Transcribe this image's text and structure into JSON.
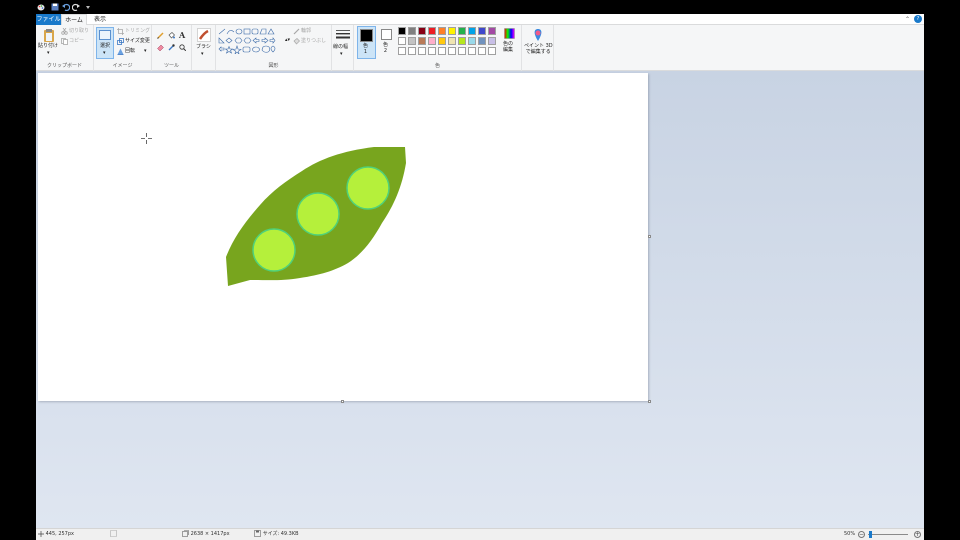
{
  "tabs": {
    "file": "ファイル",
    "home": "ホーム",
    "view": "表示"
  },
  "help": "?",
  "clipboard": {
    "paste": "貼り付け",
    "cut": "切り取り",
    "copy": "コピー",
    "label": "クリップボード"
  },
  "image": {
    "select": "選択",
    "crop": "トリミング",
    "resize": "サイズ変更",
    "rotate": "回転",
    "label": "イメージ"
  },
  "tools": {
    "text_tool": "A",
    "label": "ツール"
  },
  "brushes": {
    "label": "ブラシ"
  },
  "shapes": {
    "outline": "輪郭",
    "fill": "塗りつぶし",
    "label": "図形"
  },
  "size": {
    "label": "線の幅"
  },
  "colors": {
    "color1": "色\n1",
    "color2": "色\n2",
    "edit": "色の\n編集",
    "label": "色",
    "color1_value": "#000000",
    "color2_value": "#ffffff",
    "palette_row1": [
      "#000000",
      "#7f7f7f",
      "#880015",
      "#ed1c24",
      "#ff7f27",
      "#fff200",
      "#22b14c",
      "#00a2e8",
      "#3f48cc",
      "#a349a4"
    ],
    "palette_row2": [
      "#ffffff",
      "#c3c3c3",
      "#b97a57",
      "#ffaec9",
      "#ffc90e",
      "#efe4b0",
      "#b5e61d",
      "#99d9ea",
      "#7092be",
      "#c8bfe7"
    ],
    "palette_row3": [
      "#ffffff",
      "#ffffff",
      "#ffffff",
      "#ffffff",
      "#ffffff",
      "#ffffff",
      "#ffffff",
      "#ffffff",
      "#ffffff",
      "#ffffff"
    ]
  },
  "paint3d": {
    "label": "ペイント 3D\nで編集する"
  },
  "drawing": {
    "pod_color": "#78a51e",
    "pea_color": "#b5f03b",
    "pea_outline": "#4fd17a"
  },
  "status": {
    "cursor_pos": "445, 257px",
    "image_dims": "2638 × 1417px",
    "file_size": "サイズ: 49.3KB",
    "zoom": "50%",
    "zoom_fraction": 0.5
  }
}
